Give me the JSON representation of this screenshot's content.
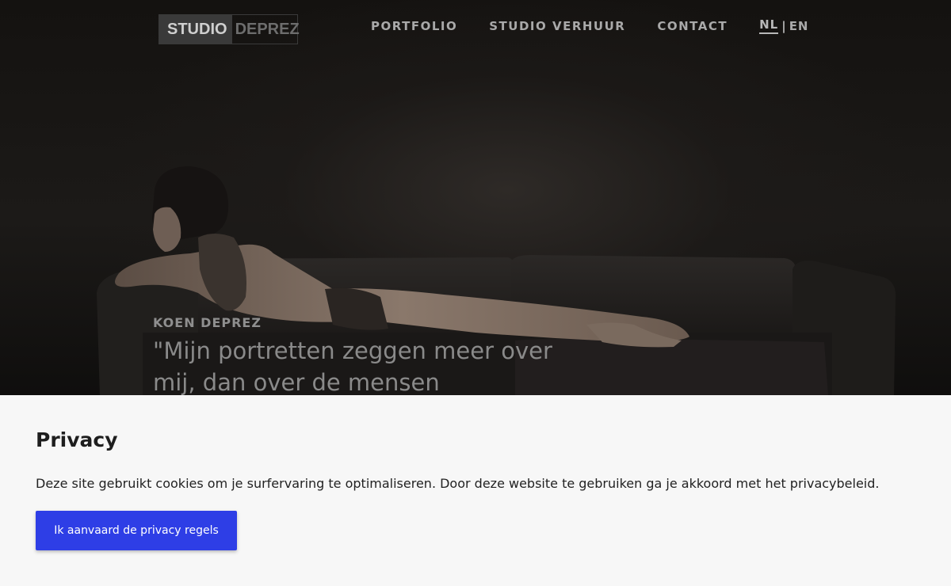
{
  "header": {
    "logo": {
      "part1": "STUDIO",
      "part2": "DEPREZ"
    },
    "nav": [
      {
        "label": "PORTFOLIO"
      },
      {
        "label": "STUDIO VERHUUR"
      },
      {
        "label": "CONTACT"
      }
    ],
    "lang": {
      "current": "NL",
      "separator": "|",
      "other": "EN"
    }
  },
  "hero": {
    "name": "KOEN DEPREZ",
    "quote": "\"Mijn portretten zeggen meer over mij, dan over de mensen"
  },
  "privacy": {
    "title": "Privacy",
    "text": "Deze site gebruikt cookies om je surfervaring te optimaliseren. Door deze website te gebruiken ga je akkoord met het privacybeleid.",
    "button_label": "Ik aanvaard de privacy regels",
    "button_color": "#2e3ee6"
  }
}
